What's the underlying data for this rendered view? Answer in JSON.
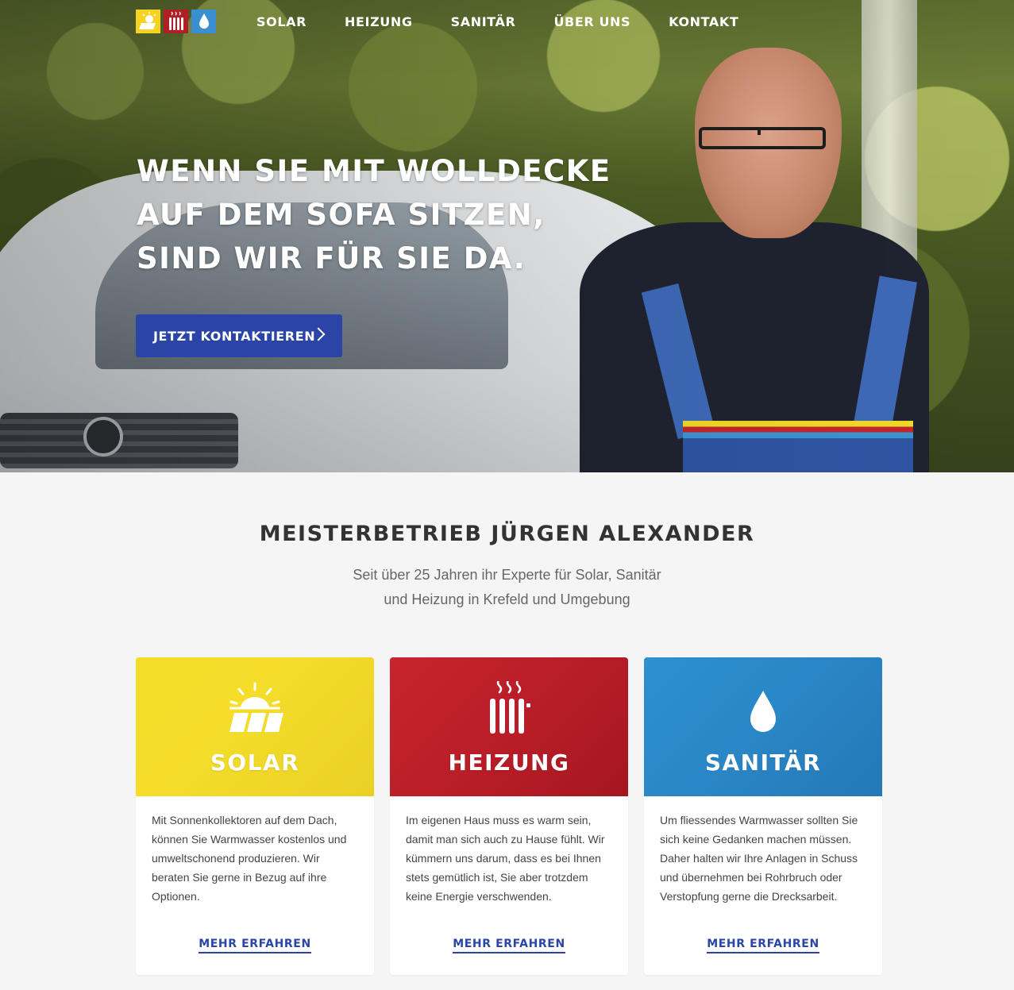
{
  "nav": {
    "items": [
      {
        "label": "SOLAR"
      },
      {
        "label": "HEIZUNG"
      },
      {
        "label": "SANITÄR"
      },
      {
        "label": "ÜBER UNS"
      },
      {
        "label": "KONTAKT"
      }
    ]
  },
  "hero": {
    "title_lines": [
      "WENN SIE MIT WOLLDECKE",
      "AUF DEM SOFA SITZEN,",
      "SIND WIR FÜR SIE DA."
    ],
    "cta_label": "JETZT KONTAKTIEREN"
  },
  "intro": {
    "title": "MEISTERBETRIEB JÜRGEN ALEXANDER",
    "subtitle_lines": [
      "Seit über 25 Jahren ihr Experte für Solar, Sanitär",
      "und Heizung in Krefeld und Umgebung"
    ]
  },
  "cards": [
    {
      "title": "SOLAR",
      "icon": "solar-panel-sun-icon",
      "color": "#f3dd28",
      "text": "Mit Sonnenkollektoren auf dem Dach, können Sie Warmwasser kostenlos und umweltschonend produzieren. Wir beraten Sie gerne in Bezug auf ihre Optionen.",
      "link": "MEHR ERFAHREN"
    },
    {
      "title": "HEIZUNG",
      "icon": "radiator-icon",
      "color": "#c7242e",
      "text": "Im eigenen Haus muss es warm sein, damit man sich auch zu Hause fühlt. Wir kümmern uns darum, dass es bei Ihnen stets gemütlich ist, Sie aber trotzdem keine Energie verschwenden.",
      "link": "MEHR ERFAHREN"
    },
    {
      "title": "SANITÄR",
      "icon": "water-drop-icon",
      "color": "#2e90cf",
      "text": "Um fliessendes Warmwasser sollten Sie sich keine Gedanken machen müssen. Daher halten wir Ihre Anlagen in Schuss und übernehmen bei Rohrbruch oder Verstopfung gerne die Drecksarbeit.",
      "link": "MEHR ERFAHREN"
    }
  ],
  "colors": {
    "primary": "#2a45a6",
    "solar": "#f6d320",
    "heizung": "#b21e26",
    "sanitaer": "#3a8fd0"
  }
}
